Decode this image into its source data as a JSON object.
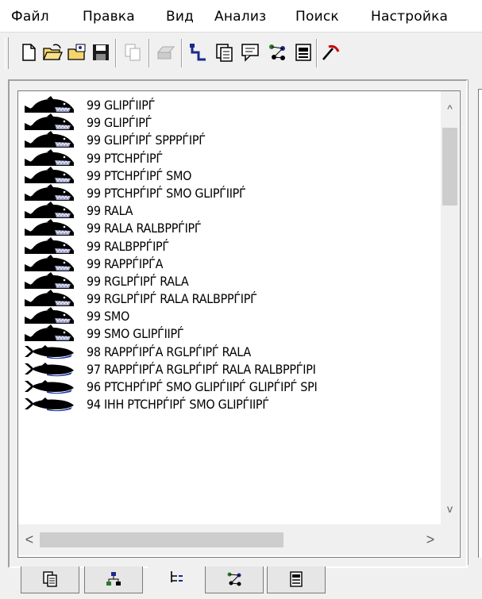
{
  "menu": [
    {
      "label": "Файл"
    },
    {
      "label": "Правка"
    },
    {
      "label": "Вид"
    },
    {
      "label": "Анализ"
    },
    {
      "label": "Поиск"
    },
    {
      "label": "Настройка"
    }
  ],
  "toolbar": {
    "buttons": [
      "new-document-icon",
      "open-folder-icon",
      "open-project-icon",
      "save-icon",
      "copy-icon",
      "print-icon",
      "tree-link-icon",
      "window-list-icon",
      "chat-icon",
      "network-icon",
      "report-icon",
      "pick-icon"
    ]
  },
  "list": {
    "items": [
      {
        "text": "99 GLIPЃIIPЃ",
        "icon": "shark"
      },
      {
        "text": "99 GLIPЃIPЃ",
        "icon": "shark"
      },
      {
        "text": "99 GLIPЃIPЃ SPPPЃIPЃ",
        "icon": "shark"
      },
      {
        "text": "99 PTCHPЃIPЃ",
        "icon": "shark"
      },
      {
        "text": "99 PTCHPЃIPЃ SMO",
        "icon": "shark"
      },
      {
        "text": "99 PTCHPЃIPЃ SMO GLIPЃIIPЃ",
        "icon": "shark"
      },
      {
        "text": "99 RALA",
        "icon": "shark"
      },
      {
        "text": "99 RALA RALBPPЃIPЃ",
        "icon": "shark"
      },
      {
        "text": "99 RALBPPЃIPЃ",
        "icon": "shark"
      },
      {
        "text": "99 RAPPЃIPЃA",
        "icon": "shark"
      },
      {
        "text": "99 RGLPЃIPЃ RALA",
        "icon": "shark"
      },
      {
        "text": "99 RGLPЃIPЃ RALA RALBPPЃIPЃ",
        "icon": "shark"
      },
      {
        "text": "99 SMO",
        "icon": "shark"
      },
      {
        "text": "99 SMO GLIPЃIIPЃ",
        "icon": "shark"
      },
      {
        "text": "98 RAPPЃIPЃA RGLPЃIPЃ RALA",
        "icon": "fish"
      },
      {
        "text": "97 RAPPЃIPЃA RGLPЃIPЃ RALA RALBPPЃIPI",
        "icon": "fish"
      },
      {
        "text": "96 PTCHPЃIPЃ SMO GLIPЃIIPЃ GLIPЃIPЃ SPI",
        "icon": "fish"
      },
      {
        "text": "94 IHH PTCHPЃIPЃ SMO GLIPЃIIPЃ",
        "icon": "fish"
      }
    ]
  },
  "scroll": {
    "up": "^",
    "down": "v",
    "left": "<",
    "right": ">"
  },
  "tabs": [
    "pages-tab-icon",
    "hierarchy-tab-icon",
    "tree-tab-icon",
    "network-tab-icon",
    "report-tab-icon"
  ],
  "colors": {
    "accent": "#1a2a8c",
    "text": "#000000"
  }
}
